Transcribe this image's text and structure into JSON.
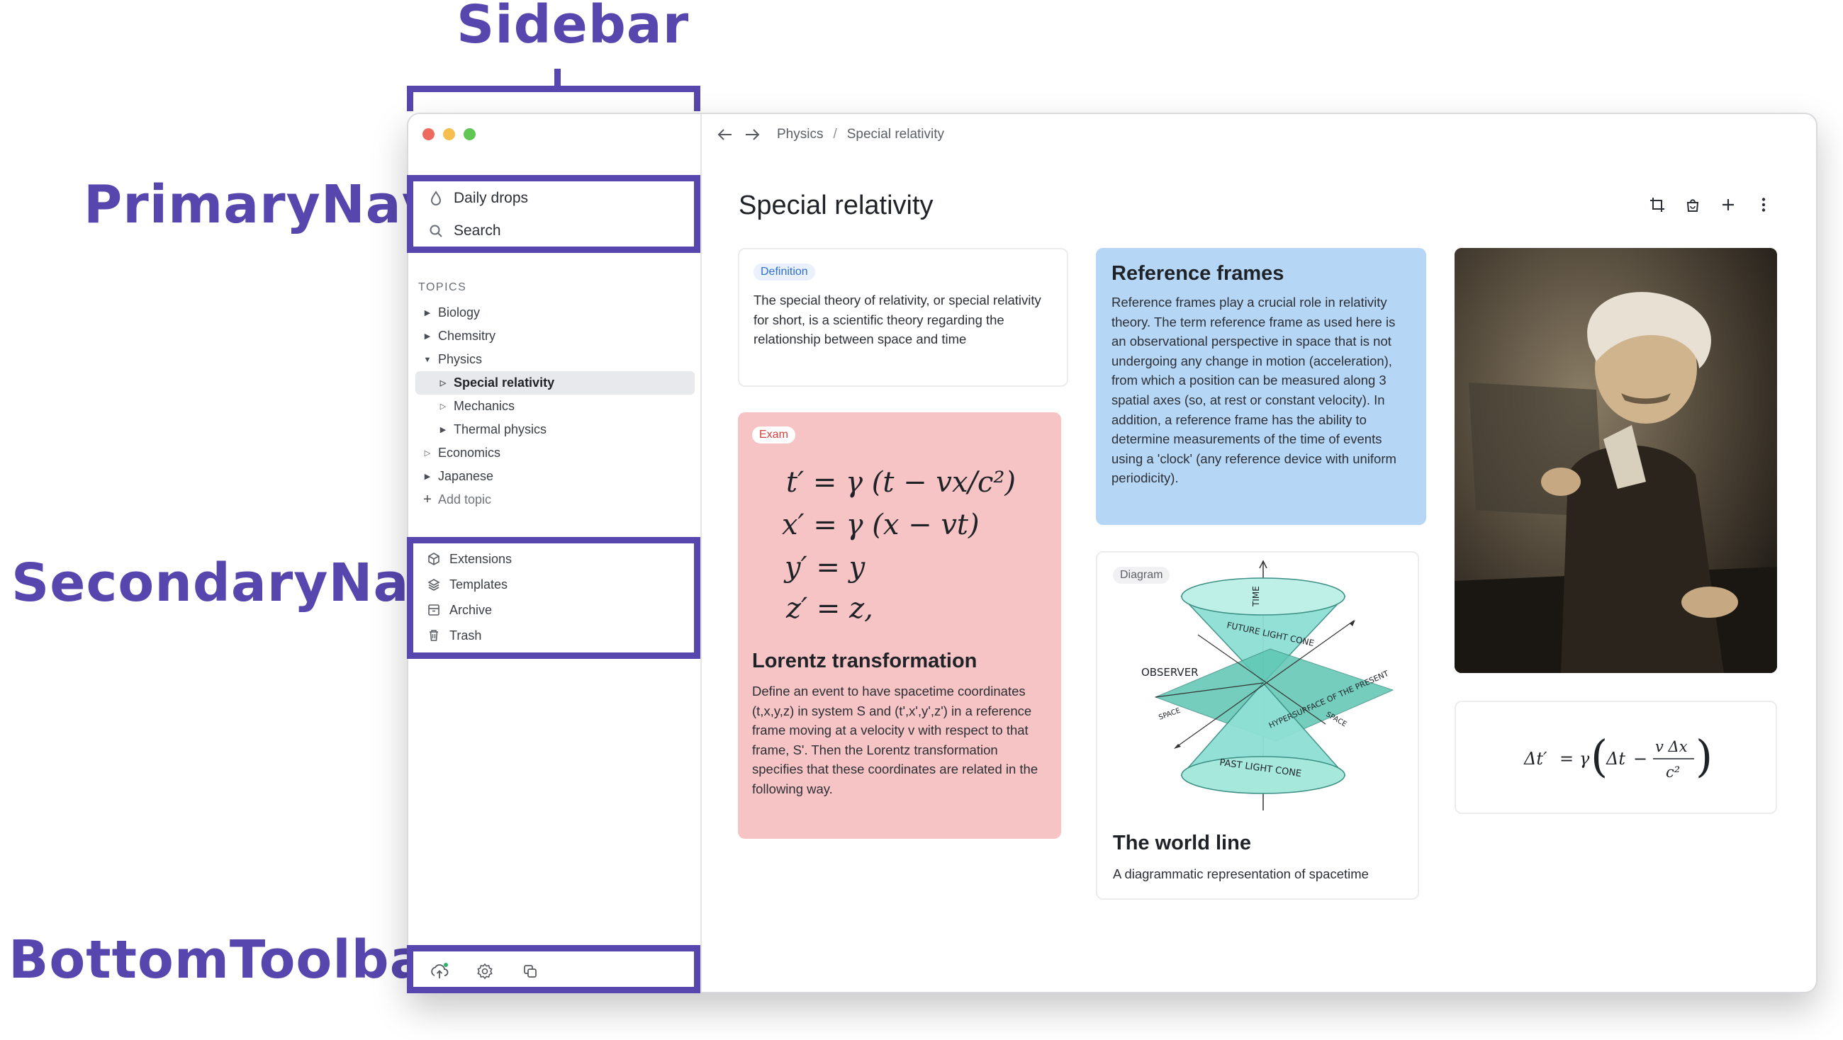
{
  "annotations": {
    "sidebar": "Sidebar",
    "primary_nav": "PrimaryNav",
    "secondary_nav": "SecondaryNav",
    "bottom_toolbar": "BottomToolbar"
  },
  "primary_nav": [
    {
      "label": "Daily drops",
      "icon": "drop-icon"
    },
    {
      "label": "Search",
      "icon": "search-icon"
    }
  ],
  "topics": {
    "title": "TOPICS",
    "items": [
      {
        "label": "Biology",
        "icon": "caret-right-filled-icon"
      },
      {
        "label": "Chemsitry",
        "icon": "caret-right-filled-icon"
      },
      {
        "label": "Physics",
        "icon": "caret-down-filled-icon"
      },
      {
        "label": "Special relativity",
        "icon": "caret-right-outline-icon"
      },
      {
        "label": "Mechanics",
        "icon": "caret-right-outline-icon"
      },
      {
        "label": "Thermal physics",
        "icon": "caret-right-filled-icon"
      },
      {
        "label": "Economics",
        "icon": "caret-right-outline-icon"
      },
      {
        "label": "Japanese",
        "icon": "caret-right-filled-icon"
      }
    ],
    "add_label": "Add topic"
  },
  "secondary_nav": [
    {
      "label": "Extensions",
      "icon": "cube-icon"
    },
    {
      "label": "Templates",
      "icon": "layers-icon"
    },
    {
      "label": "Archive",
      "icon": "archive-icon"
    },
    {
      "label": "Trash",
      "icon": "trash-icon"
    }
  ],
  "bottom_toolbar": [
    "cloud-upload-icon",
    "settings-icon",
    "copy-icon"
  ],
  "breadcrumb": [
    "Physics",
    "Special relativity"
  ],
  "page": {
    "title": "Special relativity",
    "actions": [
      "crop-icon",
      "bag-icon",
      "plus-icon",
      "more-vertical-icon"
    ]
  },
  "cards": {
    "definition": {
      "tag": "Definition",
      "text": "The special theory of relativity, or special relativity for short, is a scientific theory regarding the relationship between space and time"
    },
    "reference": {
      "title": "Reference frames",
      "text": "Reference frames play a crucial role in relativity theory. The term reference frame as used here is an observational perspective in space that is not undergoing any change in motion (acceleration), from which a position can be measured along 3 spatial axes (so, at rest or constant velocity). In addition, a reference frame has the ability to determine measurements of the time of events using a 'clock' (any reference device with uniform periodicity)."
    },
    "exam": {
      "tag": "Exam",
      "title": "Lorentz transformation",
      "text": "Define an event to have spacetime coordinates (t,x,y,z) in system S and (t',x',y',z') in a reference frame moving at a velocity v with respect to that frame, S'. Then the Lorentz transformation specifies that these coordinates are related in the following way."
    },
    "diagram": {
      "tag": "Diagram",
      "title": "The world line",
      "caption": "A diagrammatic representation of spacetime",
      "labels": {
        "time": "TIME",
        "future": "FUTURE LIGHT CONE",
        "observer": "OBSERVER",
        "hypersurface": "HYPERSURFACE OF THE PRESENT",
        "space_left": "SPACE",
        "space_right": "SPACE",
        "past": "PAST LIGHT CONE"
      }
    }
  },
  "colors": {
    "accent_annotation": "#5746ad",
    "reference_bg": "#b6d6f6",
    "exam_bg": "#f7c4c5",
    "cone": "#8ee0d4",
    "plane": "#5dc6b2"
  }
}
